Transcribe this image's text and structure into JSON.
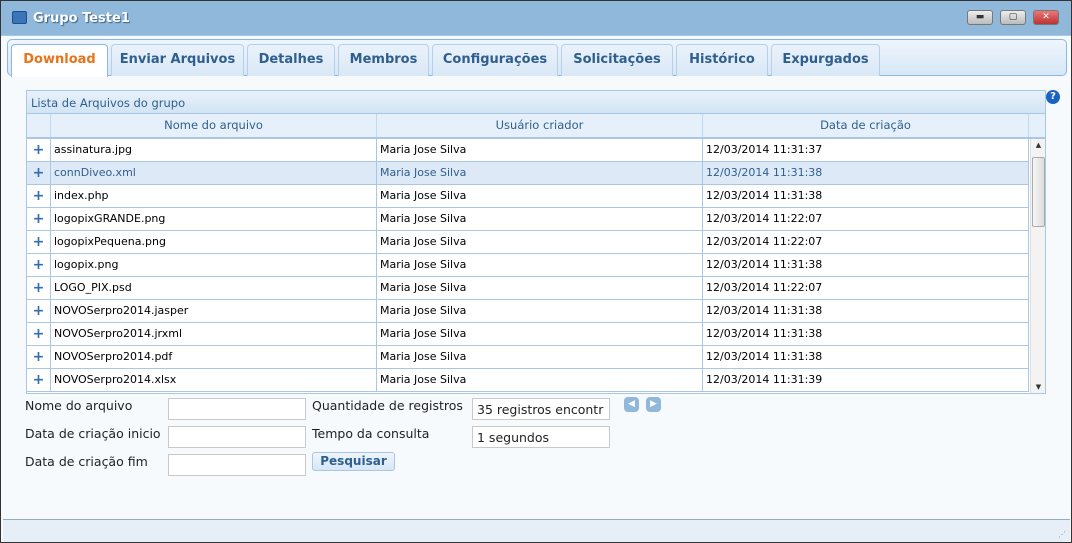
{
  "window": {
    "title": "Grupo Teste1",
    "icon": "group-icon",
    "controls": [
      "minimize-icon",
      "restore-icon",
      "close-icon"
    ]
  },
  "tabs": [
    {
      "label": "Download",
      "active": true
    },
    {
      "label": "Enviar Arquivos"
    },
    {
      "label": "Detalhes"
    },
    {
      "label": "Membros"
    },
    {
      "label": "Configurações"
    },
    {
      "label": "Solicitações"
    },
    {
      "label": "Histórico"
    },
    {
      "label": "Expurgados"
    }
  ],
  "grid": {
    "caption": "Lista de Arquivos do grupo",
    "columns": [
      "Nome do arquivo",
      "Usuário criador",
      "Data de criação"
    ],
    "rows": [
      [
        "assinatura.jpg",
        "Maria Jose Silva",
        "12/03/2014 11:31:37"
      ],
      [
        "connDiveo.xml",
        "Maria Jose Silva",
        "12/03/2014 11:31:38"
      ],
      [
        "index.php",
        "Maria Jose Silva",
        "12/03/2014 11:31:38"
      ],
      [
        "logopixGRANDE.png",
        "Maria Jose Silva",
        "12/03/2014 11:22:07"
      ],
      [
        "logopixPequena.png",
        "Maria Jose Silva",
        "12/03/2014 11:22:07"
      ],
      [
        "logopix.png",
        "Maria Jose Silva",
        "12/03/2014 11:31:38"
      ],
      [
        "LOGO_PIX.psd",
        "Maria Jose Silva",
        "12/03/2014 11:22:07"
      ],
      [
        "NOVOSerpro2014.jasper",
        "Maria Jose Silva",
        "12/03/2014 11:31:38"
      ],
      [
        "NOVOSerpro2014.jrxml",
        "Maria Jose Silva",
        "12/03/2014 11:31:38"
      ],
      [
        "NOVOSerpro2014.pdf",
        "Maria Jose Silva",
        "12/03/2014 11:31:38"
      ],
      [
        "NOVOSerpro2014.xlsx",
        "Maria Jose Silva",
        "12/03/2014 11:31:39"
      ]
    ],
    "selected_row": 1,
    "expand_symbol": "+"
  },
  "form": {
    "nome_label": "Nome do arquivo",
    "nome_value": "",
    "inicio_label": "Data de criação inicio",
    "inicio_value": "",
    "fim_label": "Data de criação fim",
    "fim_value": "",
    "qtd_label": "Quantidade de registros",
    "qtd_value": "35 registros encontr",
    "tempo_label": "Tempo da consulta",
    "tempo_value": "1 segundos",
    "search_button": "Pesquisar"
  },
  "help": "?"
}
